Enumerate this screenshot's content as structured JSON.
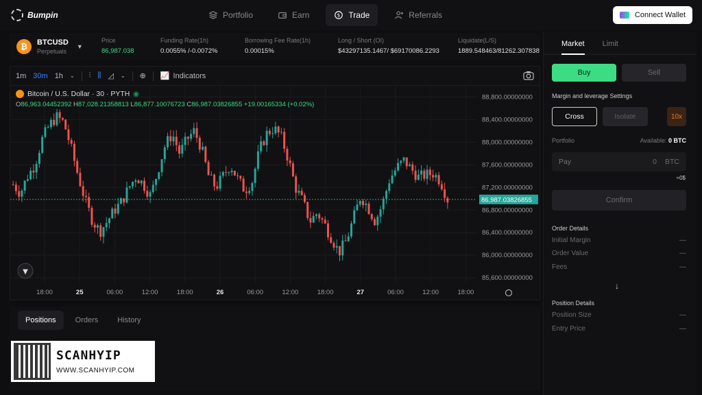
{
  "app": {
    "name": "Bumpin"
  },
  "nav": [
    {
      "label": "Portfolio",
      "icon": "layers-icon",
      "active": false
    },
    {
      "label": "Earn",
      "icon": "wallet-icon",
      "active": false
    },
    {
      "label": "Trade",
      "icon": "dollar-cycle-icon",
      "active": true
    },
    {
      "label": "Referrals",
      "icon": "user-plus-icon",
      "active": false
    }
  ],
  "connect_label": "Connect Wallet",
  "pair": {
    "symbol": "BTCUSD",
    "type": "Perpetuals",
    "icon_letter": "₿"
  },
  "stats": [
    {
      "label": "Price",
      "value": "86,987.038",
      "green": true
    },
    {
      "label": "Funding Rate(1h)",
      "value": "0.0055% /-0.0072%",
      "green": false
    },
    {
      "label": "Borrowing Fee Rate(1h)",
      "value": "0.00015%",
      "green": false
    },
    {
      "label": "Long / Short (OI)",
      "value": "$43297135.1467/ $69170086.2293",
      "green": false
    },
    {
      "label": "Liquidate(L/S)",
      "value": "1889.548463/81262.307838",
      "green": false
    }
  ],
  "toolbar": {
    "timeframes": [
      "1m",
      "30m",
      "1h"
    ],
    "active_tf": "30m",
    "indicators_label": "Indicators"
  },
  "legend": {
    "title": "Bitcoin / U.S. Dollar · 30 · PYTH",
    "o_key": "O",
    "o": "86,963.04452392",
    "h_key": "H",
    "h": "87,028.21358813",
    "l_key": "L",
    "l": "86,877.10076723",
    "c_key": "C",
    "c": "86,987.03826855",
    "change": "+19.00165334 (+0.02%)"
  },
  "chart_data": {
    "type": "candlestick",
    "title": "Bitcoin / U.S. Dollar · 30 · PYTH",
    "y_ticks": [
      88800,
      88400,
      88000,
      87600,
      87200,
      86800,
      86400,
      86000,
      85600
    ],
    "y_tick_labels": [
      "88,800.00000000",
      "88,400.00000000",
      "88,000.00000000",
      "87,600.00000000",
      "87,200.00000000",
      "86,800.00000000",
      "86,400.00000000",
      "86,000.00000000",
      "85,600.00000000"
    ],
    "ylim": [
      85480,
      89000
    ],
    "x_tick_labels": [
      "18:00",
      "25",
      "06:00",
      "12:00",
      "18:00",
      "26",
      "06:00",
      "12:00",
      "18:00",
      "27",
      "06:00",
      "12:00",
      "18:00"
    ],
    "x_bold": [
      "25",
      "26",
      "27"
    ],
    "last_price": 86987.03826855,
    "last_price_label": "86,987.03826855",
    "close_path": [
      87250,
      87100,
      87400,
      87600,
      88050,
      88300,
      88450,
      88350,
      87900,
      87400,
      86950,
      86600,
      86420,
      86600,
      86800,
      86950,
      87200,
      87400,
      87250,
      87050,
      87500,
      87950,
      88150,
      87800,
      88050,
      88200,
      87900,
      87400,
      87200,
      87400,
      87600,
      87350,
      87150,
      87300,
      87850,
      88150,
      88250,
      88100,
      87700,
      87200,
      86950,
      86600,
      86750,
      86550,
      86300,
      86050,
      86250,
      86650,
      87050,
      86850,
      86600,
      86900,
      87350,
      87550,
      87680,
      87520,
      87380,
      87420,
      87450,
      87320,
      86990
    ]
  },
  "bottom_tabs": [
    "Positions",
    "Orders",
    "History"
  ],
  "watermark": {
    "big": "SCANHYIP",
    "small": "WWW.SCANHYIP.COM"
  },
  "order": {
    "tabs": [
      "Market",
      "Limit"
    ],
    "buy": "Buy",
    "sell": "Sell",
    "margin_label": "Margin and leverage Settings",
    "cross": "Cross",
    "isolate": "Isolate",
    "leverage": "10x",
    "portfolio_label": "Portfolio",
    "available_label": "Available:",
    "available_value": "0 BTC",
    "pay_placeholder": "Pay",
    "pay_value": "0",
    "pay_unit": "BTC",
    "usd_hint": "≈0$",
    "confirm": "Confirm",
    "order_details": "Order Details",
    "order_rows": [
      {
        "label": "Initial Margin",
        "value": "—"
      },
      {
        "label": "Order Value",
        "value": "—"
      },
      {
        "label": "Fees",
        "value": "—"
      }
    ],
    "position_details": "Position Details",
    "position_rows": [
      {
        "label": "Position Size",
        "value": "—"
      },
      {
        "label": "Entry Price",
        "value": "—"
      }
    ]
  },
  "colors": {
    "up": "#26a69a",
    "down": "#ef5350",
    "accent": "#3ddc84"
  }
}
